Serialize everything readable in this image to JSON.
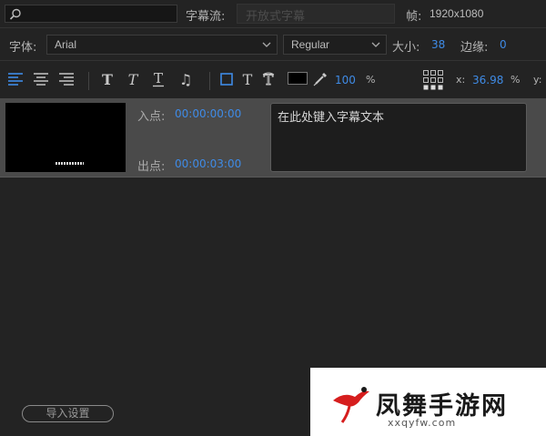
{
  "top_bar": {
    "search_placeholder": "",
    "caption_stream_label": "字幕流:",
    "caption_stream_value": "开放式字幕",
    "frame_label": "帧:",
    "frame_value": "1920x1080"
  },
  "font_row": {
    "font_label": "字体:",
    "font_value": "Arial",
    "style_value": "Regular",
    "size_label": "大小:",
    "size_value": "38",
    "edge_label": "边缘:",
    "edge_value": "0"
  },
  "format_toolbar": {
    "opacity_value": "100",
    "opacity_unit": "%",
    "x_label": "x:",
    "x_value": "36.98",
    "x_unit": "%",
    "y_label": "y:",
    "swatch_color": "#000000",
    "accent_color": "#3f8be6"
  },
  "caption": {
    "in_label": "入点:",
    "in_time": "00:00:00:00",
    "out_label": "出点:",
    "out_time": "00:00:03:00",
    "text": "在此处键入字幕文本"
  },
  "footer": {
    "import_button": "导入设置"
  },
  "watermark": {
    "title": "凤舞手游网",
    "url": "xxqyfw.com"
  }
}
